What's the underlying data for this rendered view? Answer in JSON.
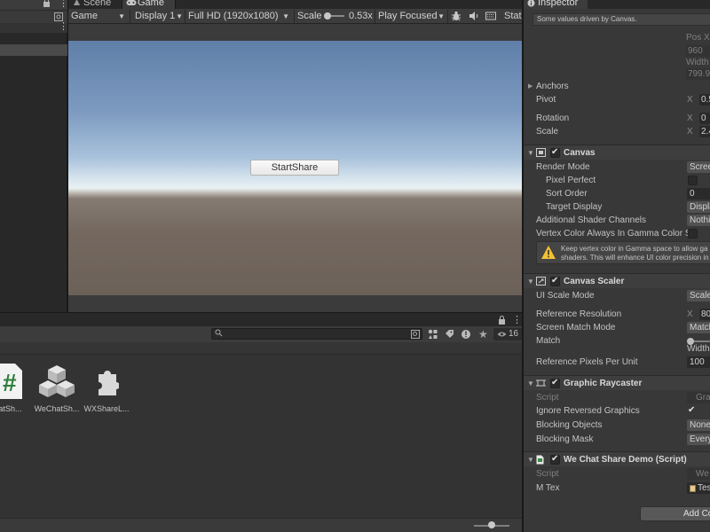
{
  "tabs": {
    "scene": "Scene",
    "game": "Game",
    "inspector": "Inspector"
  },
  "game_toolbar": {
    "view": "Game",
    "display": "Display 1",
    "resolution": "Full HD (1920x1080)",
    "scale_label": "Scale",
    "scale_value": "0.53x",
    "play_mode": "Play Focused",
    "stats": "Stat"
  },
  "viewport": {
    "button": "StartShare"
  },
  "project": {
    "assets": [
      {
        "label": "hatSh...",
        "icon": "csharp-script-icon"
      },
      {
        "label": "WeChatSh...",
        "icon": "prefab-icon"
      },
      {
        "label": "WXShareL...",
        "icon": "plugin-icon"
      }
    ],
    "visible_count": "16",
    "zoom_level": 0.5
  },
  "inspector": {
    "top_note": "Some values driven by Canvas.",
    "pos_x_label": "Pos X",
    "pos_x": "960",
    "width_label": "Width",
    "width": "799.9",
    "anchors": "Anchors",
    "pivot": {
      "label": "Pivot",
      "axis": "X",
      "value": "0.5"
    },
    "rotation": {
      "label": "Rotation",
      "axis": "X",
      "value": "0"
    },
    "scale": {
      "label": "Scale",
      "axis": "X",
      "value": "2.4"
    },
    "canvas": {
      "title": "Canvas",
      "render_mode": {
        "label": "Render Mode",
        "value": "Scree"
      },
      "pixel_perfect": "Pixel Perfect",
      "sort_order": {
        "label": "Sort Order",
        "value": "0"
      },
      "target_display": {
        "label": "Target Display",
        "value": "Displa"
      },
      "additional_channels": {
        "label": "Additional Shader Channels",
        "value": "Nothi"
      },
      "vertex_color": "Vertex Color Always In Gamma Color S",
      "help_line1": "Keep vertex color in Gamma space to allow ga",
      "help_line2": "shaders. This will enhance UI color precision in"
    },
    "canvas_scaler": {
      "title": "Canvas Scaler",
      "ui_scale_mode": {
        "label": "UI Scale Mode",
        "value": "Scale"
      },
      "reference_resolution": {
        "label": "Reference Resolution",
        "axis": "X",
        "value": "80"
      },
      "screen_match_mode": {
        "label": "Screen Match Mode",
        "value": "Match"
      },
      "match": {
        "label": "Match",
        "sublabel": "Width",
        "value": 0
      },
      "reference_ppu": {
        "label": "Reference Pixels Per Unit",
        "value": "100"
      }
    },
    "graphic_raycaster": {
      "title": "Graphic Raycaster",
      "script": {
        "label": "Script",
        "value": "Gra"
      },
      "ignore_reversed": "Ignore Reversed Graphics",
      "blocking_objects": {
        "label": "Blocking Objects",
        "value": "None"
      },
      "blocking_mask": {
        "label": "Blocking Mask",
        "value": "Every"
      }
    },
    "wechat_demo": {
      "title": "We Chat Share Demo (Script)",
      "script": {
        "label": "Script",
        "value": "We"
      },
      "m_tex": {
        "label": "M Tex",
        "value": "Tes"
      }
    },
    "add_component": "Add Co"
  }
}
